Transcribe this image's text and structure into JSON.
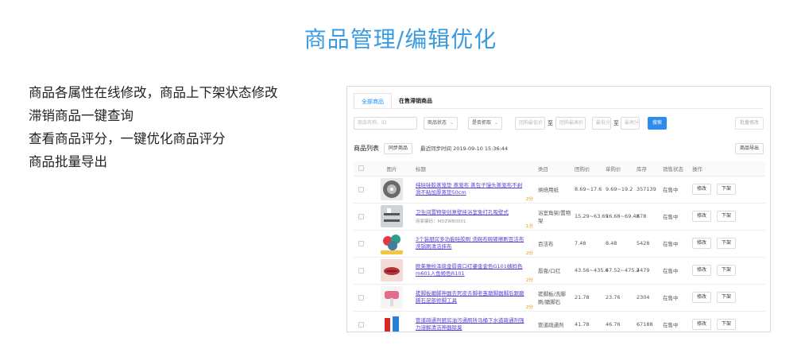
{
  "page": {
    "title": "商品管理/编辑优化",
    "features": [
      "商品各属性在线修改，商品上下架状态修改",
      "滞销商品一键查询",
      "查看商品评分，一键优化商品评分",
      "商品批量导出"
    ]
  },
  "screenshot": {
    "tabs": [
      {
        "label": "全部商品",
        "active": true
      },
      {
        "label": "在售滞销商品",
        "active": false
      }
    ],
    "filters": {
      "name_placeholder": "商品名称、ID",
      "status_select": "商品状态",
      "capture_select": "是否抓取",
      "price_min_placeholder": "团购最低价",
      "to_label": "至",
      "price_max_placeholder": "团购最高价",
      "score_min_placeholder": "最低分",
      "score_max_placeholder": "最高分",
      "search_label": "搜索",
      "batch_edit_label": "批量修改"
    },
    "list": {
      "title": "商品列表",
      "sync_label": "同步商品",
      "sync_time": "最近同步时间 2019-09-10 15:36:44",
      "export_label": "商品导出"
    },
    "columns": [
      "图片",
      "标题",
      "类目",
      "团购价",
      "单购价",
      "库存",
      "销售状态",
      "操作"
    ],
    "rows": [
      {
        "title": "纯硅硅胶蒸笼垫 蒸笼布 蒸包子馒头蒸笼布不剥滑不粘加厚蒸垫50cm",
        "sku": "",
        "score": "2分",
        "category": "烘焙用纸",
        "group_price": "8.69~17.6",
        "single_price": "9.69~19.2",
        "stock": "357139",
        "status": "在售中",
        "edit": "修改",
        "offline": "下架",
        "thumb": "round-dark"
      },
      {
        "title": "卫生间置物架创意壁挂浴室免打孔吸壁式",
        "sku": "商家编码：MDZWB0001",
        "score": "1分",
        "category": "浴室角架/置物架",
        "group_price": "15.29~63.69",
        "single_price": "16.68~69.48",
        "stock": "878",
        "status": "在售中",
        "edit": "修改",
        "offline": "下架",
        "thumb": "shelf"
      },
      {
        "title": "3个装厨房多功能硅胶刷 洗碗布碗碟擦刷百洁布洗锅刷清洁抹布",
        "sku": "",
        "score": "2分",
        "category": "百洁布",
        "group_price": "7.48",
        "single_price": "8.48",
        "stock": "5428",
        "status": "在售中",
        "edit": "修改",
        "offline": "下架",
        "thumb": "colorful"
      },
      {
        "title": "欧莱雅纷泽琉金唇膏口红鎏金金色G101姨妈色m601人鱼姬色R101",
        "sku": "",
        "score": "2分",
        "category": "唇膏/口红",
        "group_price": "43.56~435.6",
        "single_price": "47.52~475.2",
        "stock": "4479",
        "status": "在售中",
        "edit": "修改",
        "offline": "下架",
        "thumb": "lips"
      },
      {
        "title": "搓脚板磨脚神器去死皮去脚老茧磨脚器脚后跟磨脚石足部修脚工具",
        "sku": "",
        "score": "2分",
        "category": "搓脚板/洗脚刷/磨脚石",
        "group_price": "21.78",
        "single_price": "23.76",
        "stock": "2304",
        "status": "在售中",
        "edit": "修改",
        "offline": "下架",
        "thumb": "tool"
      },
      {
        "title": "管道疏通剂厨房油污通厕所马桶下水道疏通剂强力溶解清洁神器除臭",
        "sku": "",
        "score": "",
        "category": "管道疏通剂",
        "group_price": "41.78",
        "single_price": "46.76",
        "stock": "67188",
        "status": "在售中",
        "edit": "修改",
        "offline": "下架",
        "thumb": "bottle"
      }
    ]
  },
  "colors": {
    "accent": "#3a9be0",
    "button": "#2d8cf0",
    "link": "#5a3fd0",
    "score": "#f08c00"
  }
}
